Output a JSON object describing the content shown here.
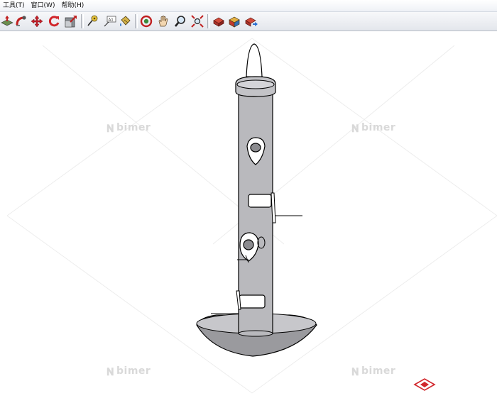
{
  "menubar": {
    "items": [
      "工具(T)",
      "窗口(W)",
      "帮助(H)"
    ]
  },
  "toolbar": {
    "groups": [
      [
        "push-pull-icon",
        "follow-me-icon",
        "move-icon",
        "rotate-icon",
        "scale-icon"
      ],
      [
        "tape-measure-icon",
        "text-label-icon",
        "paint-bucket-icon"
      ],
      [
        "orbit-icon",
        "pan-icon",
        "zoom-icon",
        "zoom-extents-icon"
      ],
      [
        "components-icon",
        "materials-icon",
        "share-model-icon"
      ]
    ]
  },
  "colors": {
    "model_fill": "#b9b9bd",
    "model_edge": "#000000",
    "watermark": "#d9d9d9",
    "accent_red": "#d1262b"
  },
  "watermark_text": "bimer"
}
